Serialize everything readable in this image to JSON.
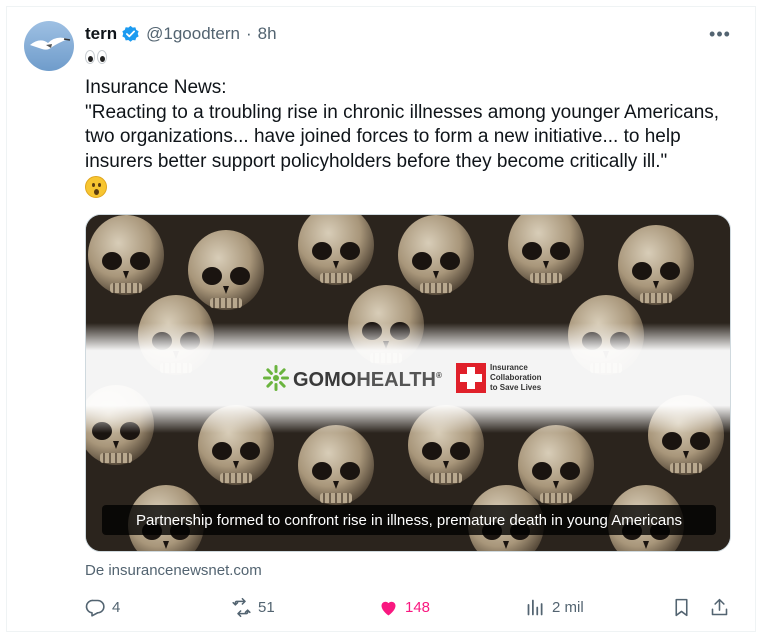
{
  "tweet": {
    "author_name": "tern",
    "handle": "@1goodtern",
    "separator": "·",
    "time": "8h",
    "more_label": "•••",
    "lines": [
      "Insurance News:",
      "\"Reacting to a troubling rise in chronic illnesses among younger Americans,",
      "two organizations... have joined forces to form a new initiative... to help",
      "insurers better support policyholders before they become critically ill.\""
    ]
  },
  "card": {
    "brand_gomo": "GOMO",
    "brand_health": "HEALTH",
    "brand_reg": "®",
    "icsl_line1": "Insurance",
    "icsl_line2": "Collaboration",
    "icsl_line3": "to Save Lives",
    "caption": "Partnership formed to confront rise in illness, premature death in young Americans",
    "source": "De insurancenewsnet.com"
  },
  "actions": {
    "replies": "4",
    "reposts": "51",
    "likes": "148",
    "views": "2 mil"
  },
  "colors": {
    "like": "#f91880",
    "verified": "#1d9bf0",
    "muted": "#536471",
    "gomo_green": "#6ab43e",
    "icsl_red": "#e0202a"
  },
  "icons": [
    "avatar-bird",
    "verified-badge-icon",
    "more-icon",
    "eyes-emoji",
    "astonished-emoji",
    "reply-icon",
    "repost-icon",
    "heart-icon",
    "views-icon",
    "bookmark-icon",
    "share-icon"
  ]
}
